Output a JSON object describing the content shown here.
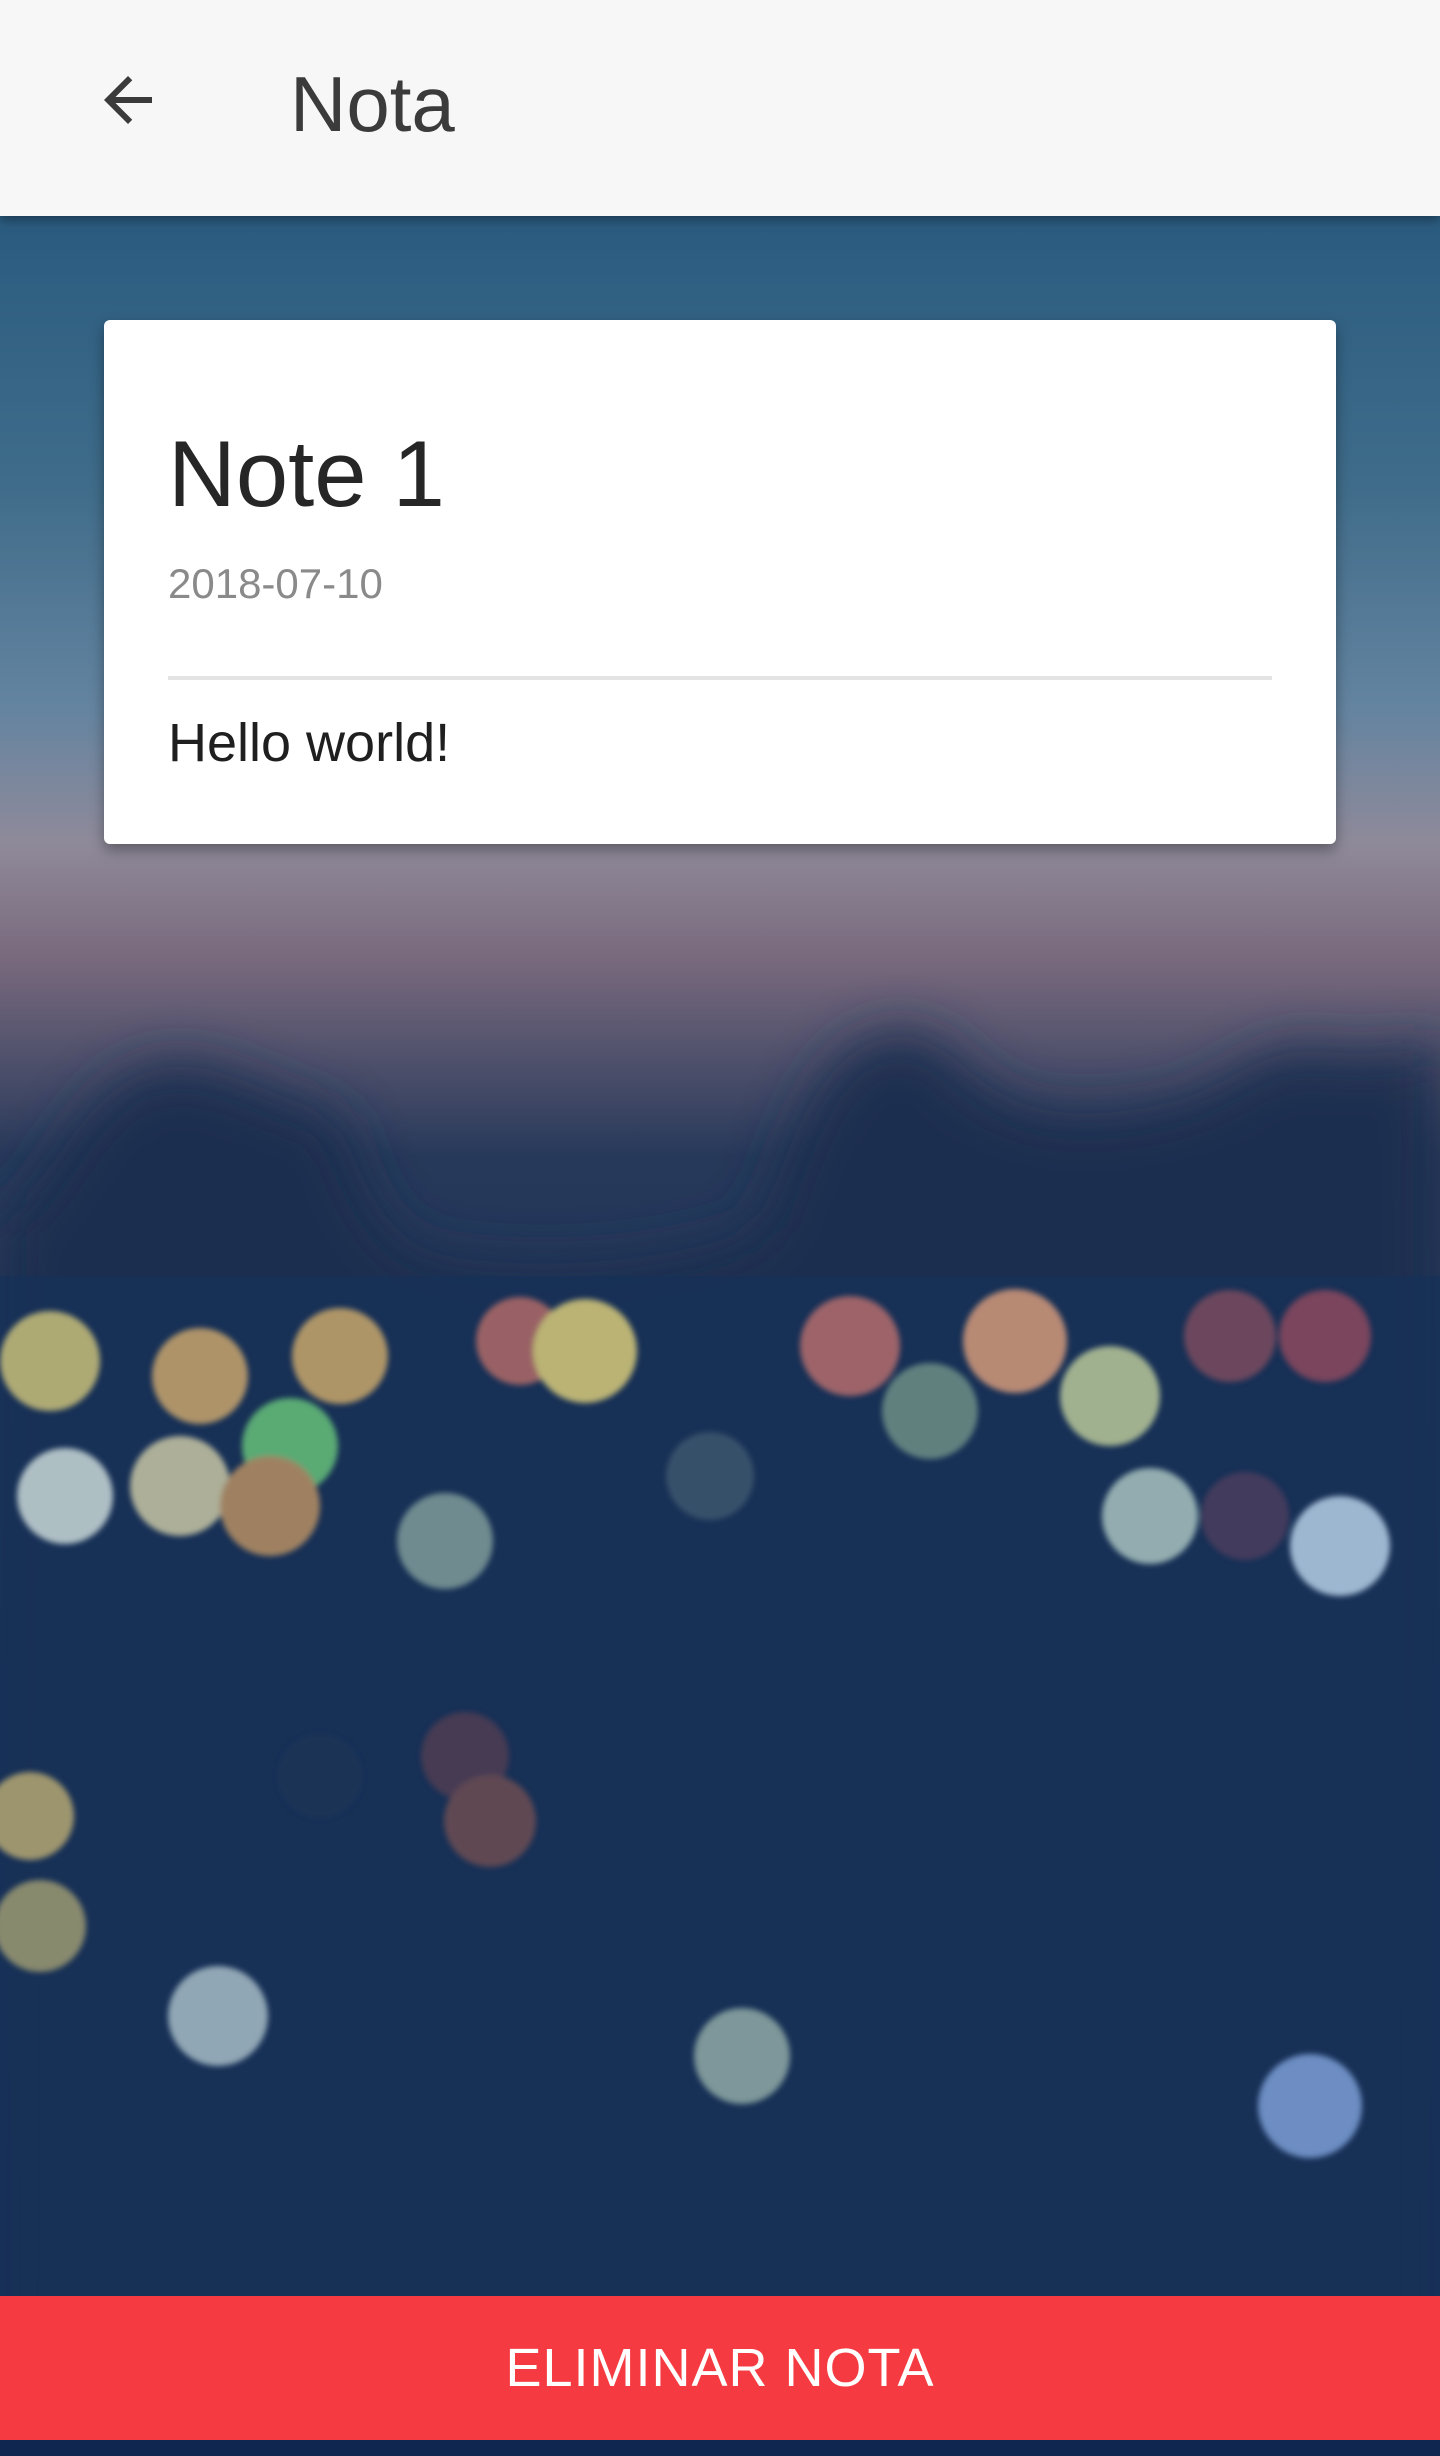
{
  "header": {
    "title": "Nota",
    "back_icon": "arrow-left-icon"
  },
  "note": {
    "title": "Note 1",
    "date": "2018-07-10",
    "body": "Hello world!"
  },
  "actions": {
    "delete_label": "ELIMINAR NOTA"
  },
  "colors": {
    "app_bar": "#f7f7f7",
    "delete_button": "#f53b41",
    "card": "#ffffff"
  }
}
